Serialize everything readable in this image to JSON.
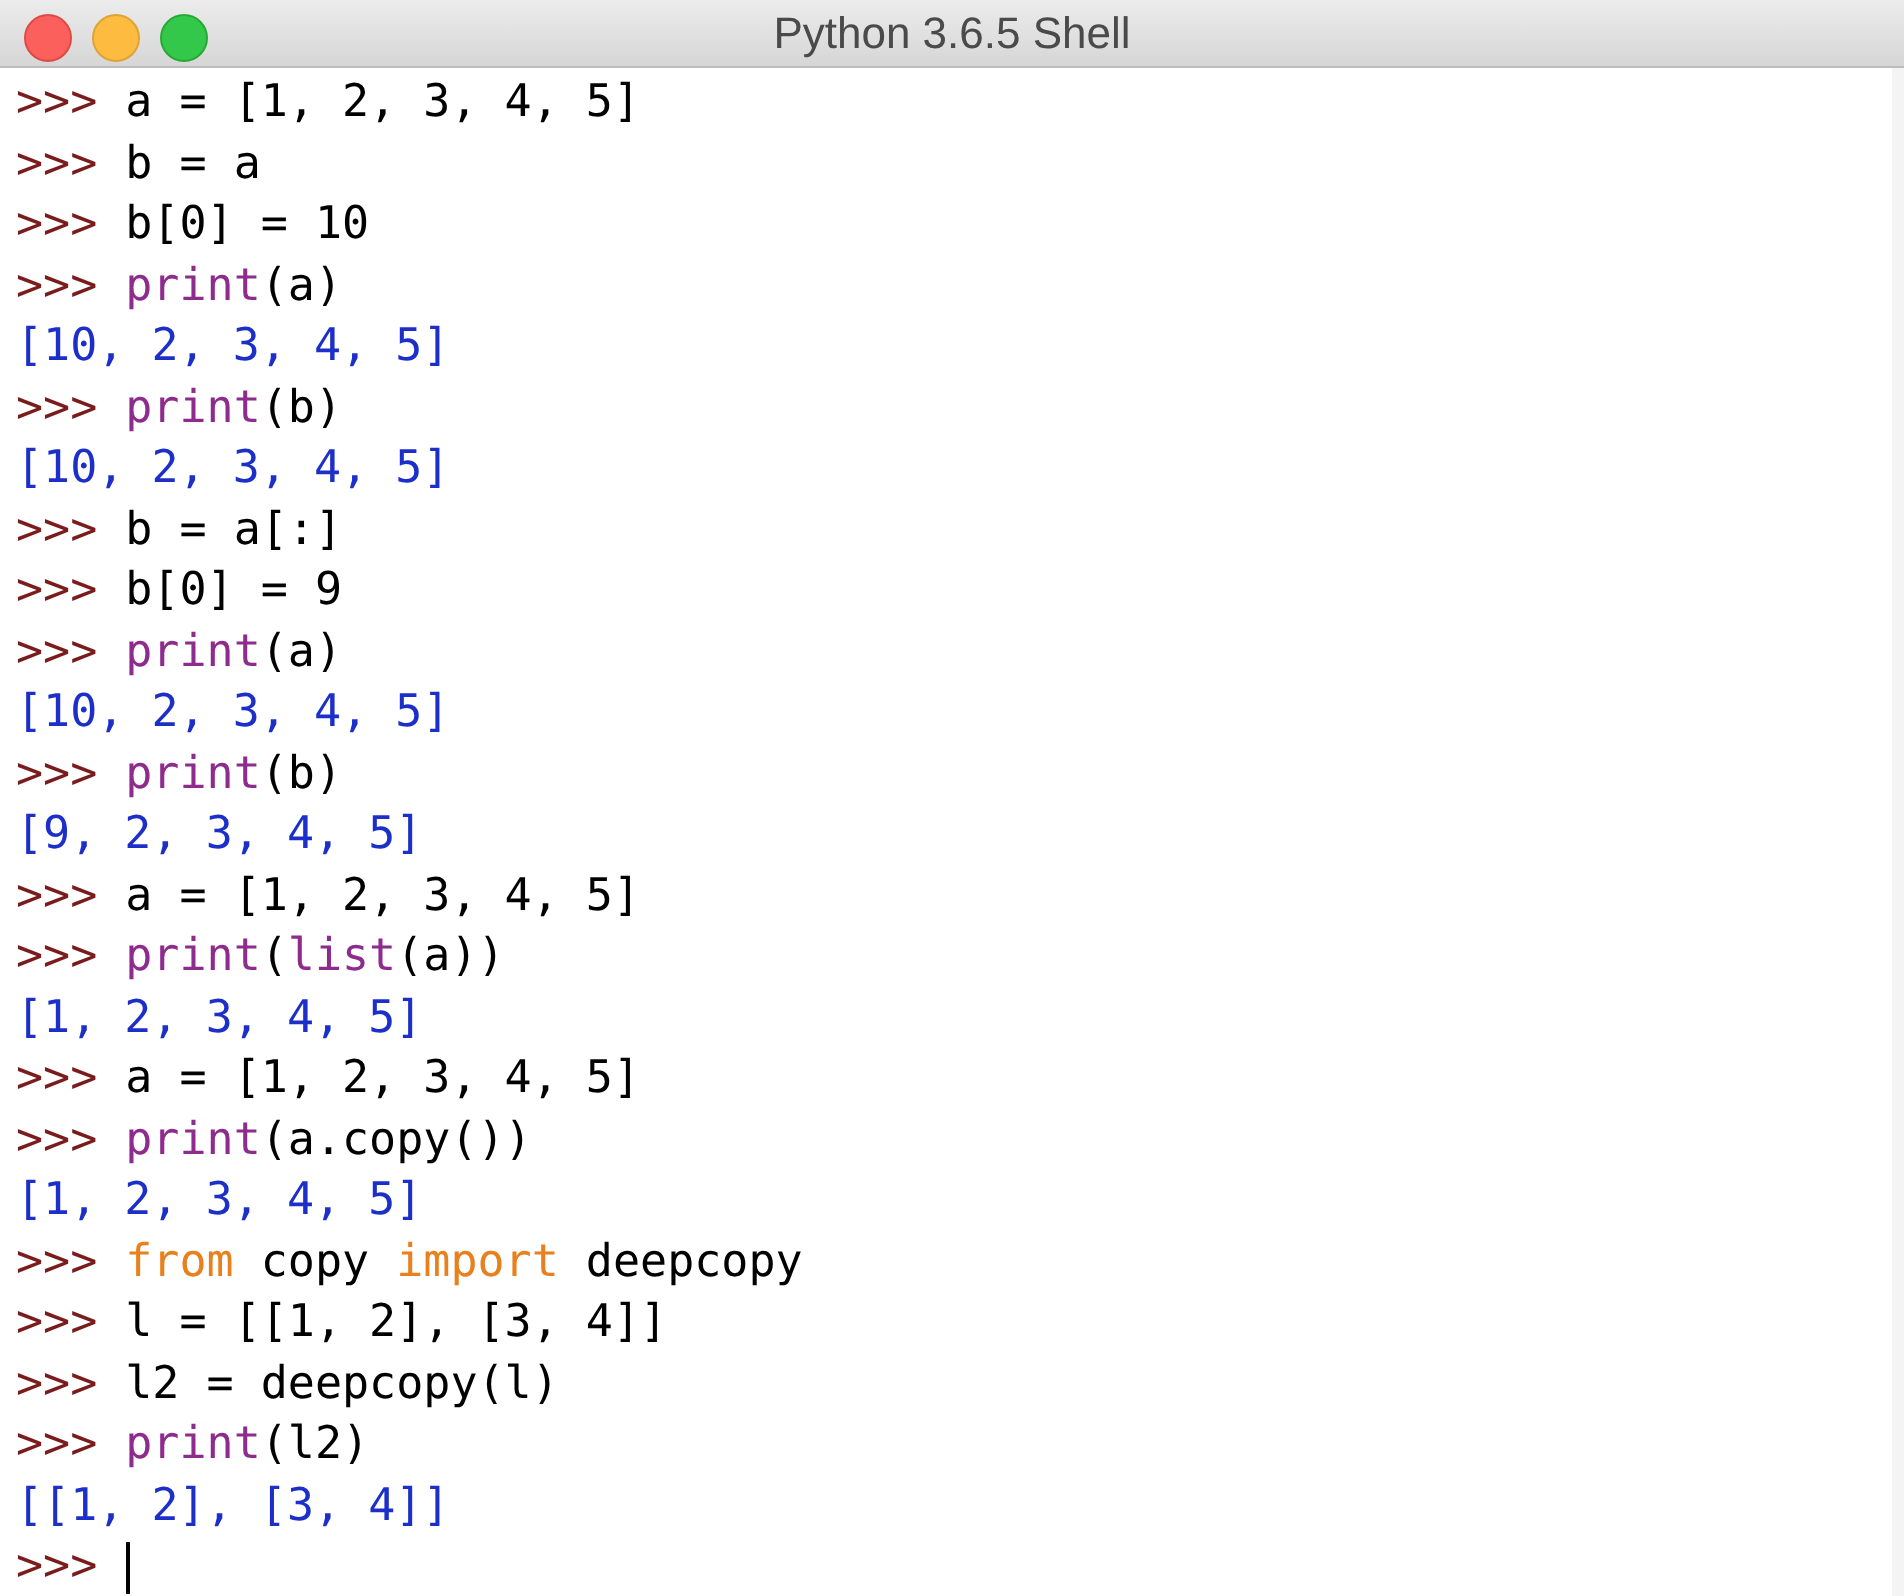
{
  "window": {
    "title": "Python 3.6.5 Shell"
  },
  "lines": [
    {
      "kind": "input",
      "prompt": ">>>",
      "tokens": [
        {
          "kind": "plain",
          "text": "a = [1, 2, 3, 4, 5]"
        }
      ]
    },
    {
      "kind": "input",
      "prompt": ">>>",
      "tokens": [
        {
          "kind": "plain",
          "text": "b = a"
        }
      ]
    },
    {
      "kind": "input",
      "prompt": ">>>",
      "tokens": [
        {
          "kind": "plain",
          "text": "b[0] = 10"
        }
      ]
    },
    {
      "kind": "input",
      "prompt": ">>>",
      "tokens": [
        {
          "kind": "builtin",
          "text": "print"
        },
        {
          "kind": "plain",
          "text": "(a)"
        }
      ]
    },
    {
      "kind": "output",
      "text": "[10, 2, 3, 4, 5]"
    },
    {
      "kind": "input",
      "prompt": ">>>",
      "tokens": [
        {
          "kind": "builtin",
          "text": "print"
        },
        {
          "kind": "plain",
          "text": "(b)"
        }
      ]
    },
    {
      "kind": "output",
      "text": "[10, 2, 3, 4, 5]"
    },
    {
      "kind": "input",
      "prompt": ">>>",
      "tokens": [
        {
          "kind": "plain",
          "text": "b = a[:]"
        }
      ]
    },
    {
      "kind": "input",
      "prompt": ">>>",
      "tokens": [
        {
          "kind": "plain",
          "text": "b[0] = 9"
        }
      ]
    },
    {
      "kind": "input",
      "prompt": ">>>",
      "tokens": [
        {
          "kind": "builtin",
          "text": "print"
        },
        {
          "kind": "plain",
          "text": "(a)"
        }
      ]
    },
    {
      "kind": "output",
      "text": "[10, 2, 3, 4, 5]"
    },
    {
      "kind": "input",
      "prompt": ">>>",
      "tokens": [
        {
          "kind": "builtin",
          "text": "print"
        },
        {
          "kind": "plain",
          "text": "(b)"
        }
      ]
    },
    {
      "kind": "output",
      "text": "[9, 2, 3, 4, 5]"
    },
    {
      "kind": "input",
      "prompt": ">>>",
      "tokens": [
        {
          "kind": "plain",
          "text": "a = [1, 2, 3, 4, 5]"
        }
      ]
    },
    {
      "kind": "input",
      "prompt": ">>>",
      "tokens": [
        {
          "kind": "builtin",
          "text": "print"
        },
        {
          "kind": "plain",
          "text": "("
        },
        {
          "kind": "builtin",
          "text": "list"
        },
        {
          "kind": "plain",
          "text": "(a))"
        }
      ]
    },
    {
      "kind": "output",
      "text": "[1, 2, 3, 4, 5]"
    },
    {
      "kind": "input",
      "prompt": ">>>",
      "tokens": [
        {
          "kind": "plain",
          "text": "a = [1, 2, 3, 4, 5]"
        }
      ]
    },
    {
      "kind": "input",
      "prompt": ">>>",
      "tokens": [
        {
          "kind": "builtin",
          "text": "print"
        },
        {
          "kind": "plain",
          "text": "(a.copy())"
        }
      ]
    },
    {
      "kind": "output",
      "text": "[1, 2, 3, 4, 5]"
    },
    {
      "kind": "input",
      "prompt": ">>>",
      "tokens": [
        {
          "kind": "keyword",
          "text": "from"
        },
        {
          "kind": "plain",
          "text": " copy "
        },
        {
          "kind": "keyword",
          "text": "import"
        },
        {
          "kind": "plain",
          "text": " deepcopy"
        }
      ]
    },
    {
      "kind": "input",
      "prompt": ">>>",
      "tokens": [
        {
          "kind": "plain",
          "text": "l = [[1, 2], [3, 4]]"
        }
      ]
    },
    {
      "kind": "input",
      "prompt": ">>>",
      "tokens": [
        {
          "kind": "plain",
          "text": "l2 = deepcopy(l)"
        }
      ]
    },
    {
      "kind": "input",
      "prompt": ">>>",
      "tokens": [
        {
          "kind": "builtin",
          "text": "print"
        },
        {
          "kind": "plain",
          "text": "(l2)"
        }
      ]
    },
    {
      "kind": "output",
      "text": "[[1, 2], [3, 4]]"
    },
    {
      "kind": "cursor",
      "prompt": ">>>"
    }
  ]
}
